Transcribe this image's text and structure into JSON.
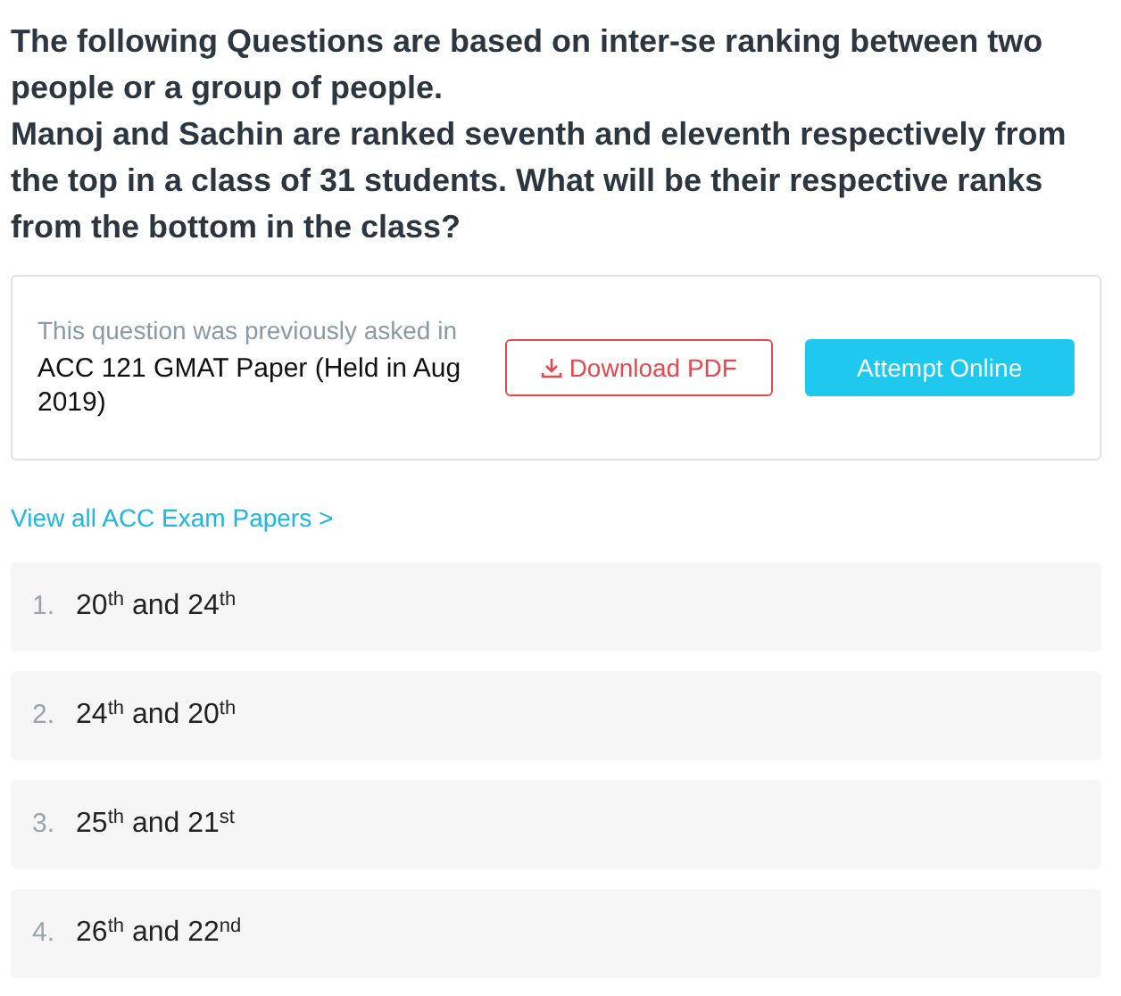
{
  "question": {
    "intro": "The following Questions are based on inter-se ranking between two people or a group of people.",
    "text": "Manoj and Sachin are ranked seventh and eleventh respectively from the top in a class of 31 students. What will be their respective ranks from the bottom in the class?"
  },
  "previous": {
    "label": "This question was previously asked in",
    "paper": "ACC 121 GMAT Paper (Held in Aug 2019)",
    "download": "Download PDF",
    "attempt": "Attempt Online"
  },
  "view_all": "View all ACC Exam Papers >",
  "options": [
    {
      "number": "1.",
      "text": "20$^{th}$ and 24$^{th}$"
    },
    {
      "number": "2.",
      "text": "24$^{th}$ and 20$^{th}$"
    },
    {
      "number": "3.",
      "text": "25$^{th}$ and 21$^{st}$"
    },
    {
      "number": "4.",
      "text": "26$^{th}$ and 22$^{nd}$"
    }
  ]
}
